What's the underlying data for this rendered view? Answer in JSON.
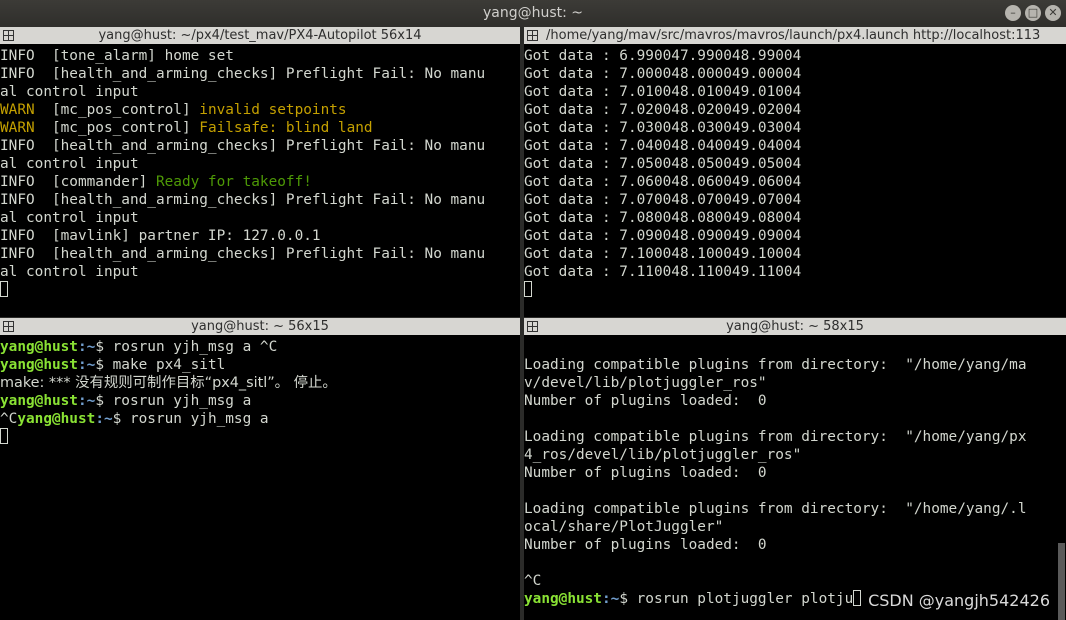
{
  "window": {
    "title": "yang@hust: ~"
  },
  "panes": {
    "top_left": {
      "title": "yang@hust: ~/px4/test_mav/PX4-Autopilot 56x14",
      "lines": [
        [
          {
            "t": "INFO  [tone_alarm] home set",
            "c": "info"
          }
        ],
        [
          {
            "t": "INFO  [health_and_arming_checks] Preflight Fail: No manu",
            "c": "info"
          }
        ],
        [
          {
            "t": "al control input",
            "c": "info"
          }
        ],
        [
          {
            "t": "WARN  ",
            "c": "warn"
          },
          {
            "t": "[mc_pos_control] ",
            "c": "info"
          },
          {
            "t": "invalid setpoints",
            "c": "warn"
          }
        ],
        [
          {
            "t": "WARN  ",
            "c": "warn"
          },
          {
            "t": "[mc_pos_control] ",
            "c": "info"
          },
          {
            "t": "Failsafe: blind land",
            "c": "warn"
          }
        ],
        [
          {
            "t": "INFO  [health_and_arming_checks] Preflight Fail: No manu",
            "c": "info"
          }
        ],
        [
          {
            "t": "al control input",
            "c": "info"
          }
        ],
        [
          {
            "t": "INFO  [commander] ",
            "c": "info"
          },
          {
            "t": "Ready for takeoff!",
            "c": "green"
          }
        ],
        [
          {
            "t": "INFO  [health_and_arming_checks] Preflight Fail: No manu",
            "c": "info"
          }
        ],
        [
          {
            "t": "al control input",
            "c": "info"
          }
        ],
        [
          {
            "t": "INFO  [mavlink] partner IP: 127.0.0.1",
            "c": "info"
          }
        ],
        [
          {
            "t": "INFO  [health_and_arming_checks] Preflight Fail: No manu",
            "c": "info"
          }
        ],
        [
          {
            "t": "al control input",
            "c": "info"
          }
        ]
      ]
    },
    "top_right": {
      "title": "/home/yang/mav/src/mavros/mavros/launch/px4.launch http://localhost:113",
      "lines": [
        "Got data : 6.990047.990048.99004",
        "Got data : 7.000048.000049.00004",
        "Got data : 7.010048.010049.01004",
        "Got data : 7.020048.020049.02004",
        "Got data : 7.030048.030049.03004",
        "Got data : 7.040048.040049.04004",
        "Got data : 7.050048.050049.05004",
        "Got data : 7.060048.060049.06004",
        "Got data : 7.070048.070049.07004",
        "Got data : 7.080048.080049.08004",
        "Got data : 7.090048.090049.09004",
        "Got data : 7.100048.100049.10004",
        "Got data : 7.110048.110049.11004"
      ]
    },
    "bottom_left": {
      "title": "yang@hust: ~ 56x15",
      "prompt_user": "yang@hust",
      "prompt_path": ":~",
      "lines": [
        {
          "pre": "",
          "cmd": "$ rosrun yjh_msg a ^C",
          "prompt": true
        },
        {
          "pre": "",
          "cmd": "$ make px4_sitl",
          "prompt": true
        },
        {
          "pre": "",
          "cmd": "make: *** 没有规则可制作目标“px4_sitl”。 停止。",
          "prompt": false
        },
        {
          "pre": "",
          "cmd": "$ rosrun yjh_msg a",
          "prompt": true
        },
        {
          "pre": "^C",
          "cmd": "$ rosrun yjh_msg a",
          "prompt": true
        }
      ]
    },
    "bottom_right": {
      "title": "yang@hust: ~ 58x15",
      "lines": [
        "",
        "Loading compatible plugins from directory:  \"/home/yang/ma",
        "v/devel/lib/plotjuggler_ros\"",
        "Number of plugins loaded:  0",
        "",
        "Loading compatible plugins from directory:  \"/home/yang/px",
        "4_ros/devel/lib/plotjuggler_ros\"",
        "Number of plugins loaded:  0",
        "",
        "Loading compatible plugins from directory:  \"/home/yang/.l",
        "ocal/share/PlotJuggler\"",
        "Number of plugins loaded:  0",
        "",
        "^C"
      ],
      "prompt_user": "yang@hust",
      "prompt_path": ":~",
      "last_cmd": "$ rosrun plotjuggler plotju"
    }
  },
  "watermark": "CSDN @yangjh542426"
}
